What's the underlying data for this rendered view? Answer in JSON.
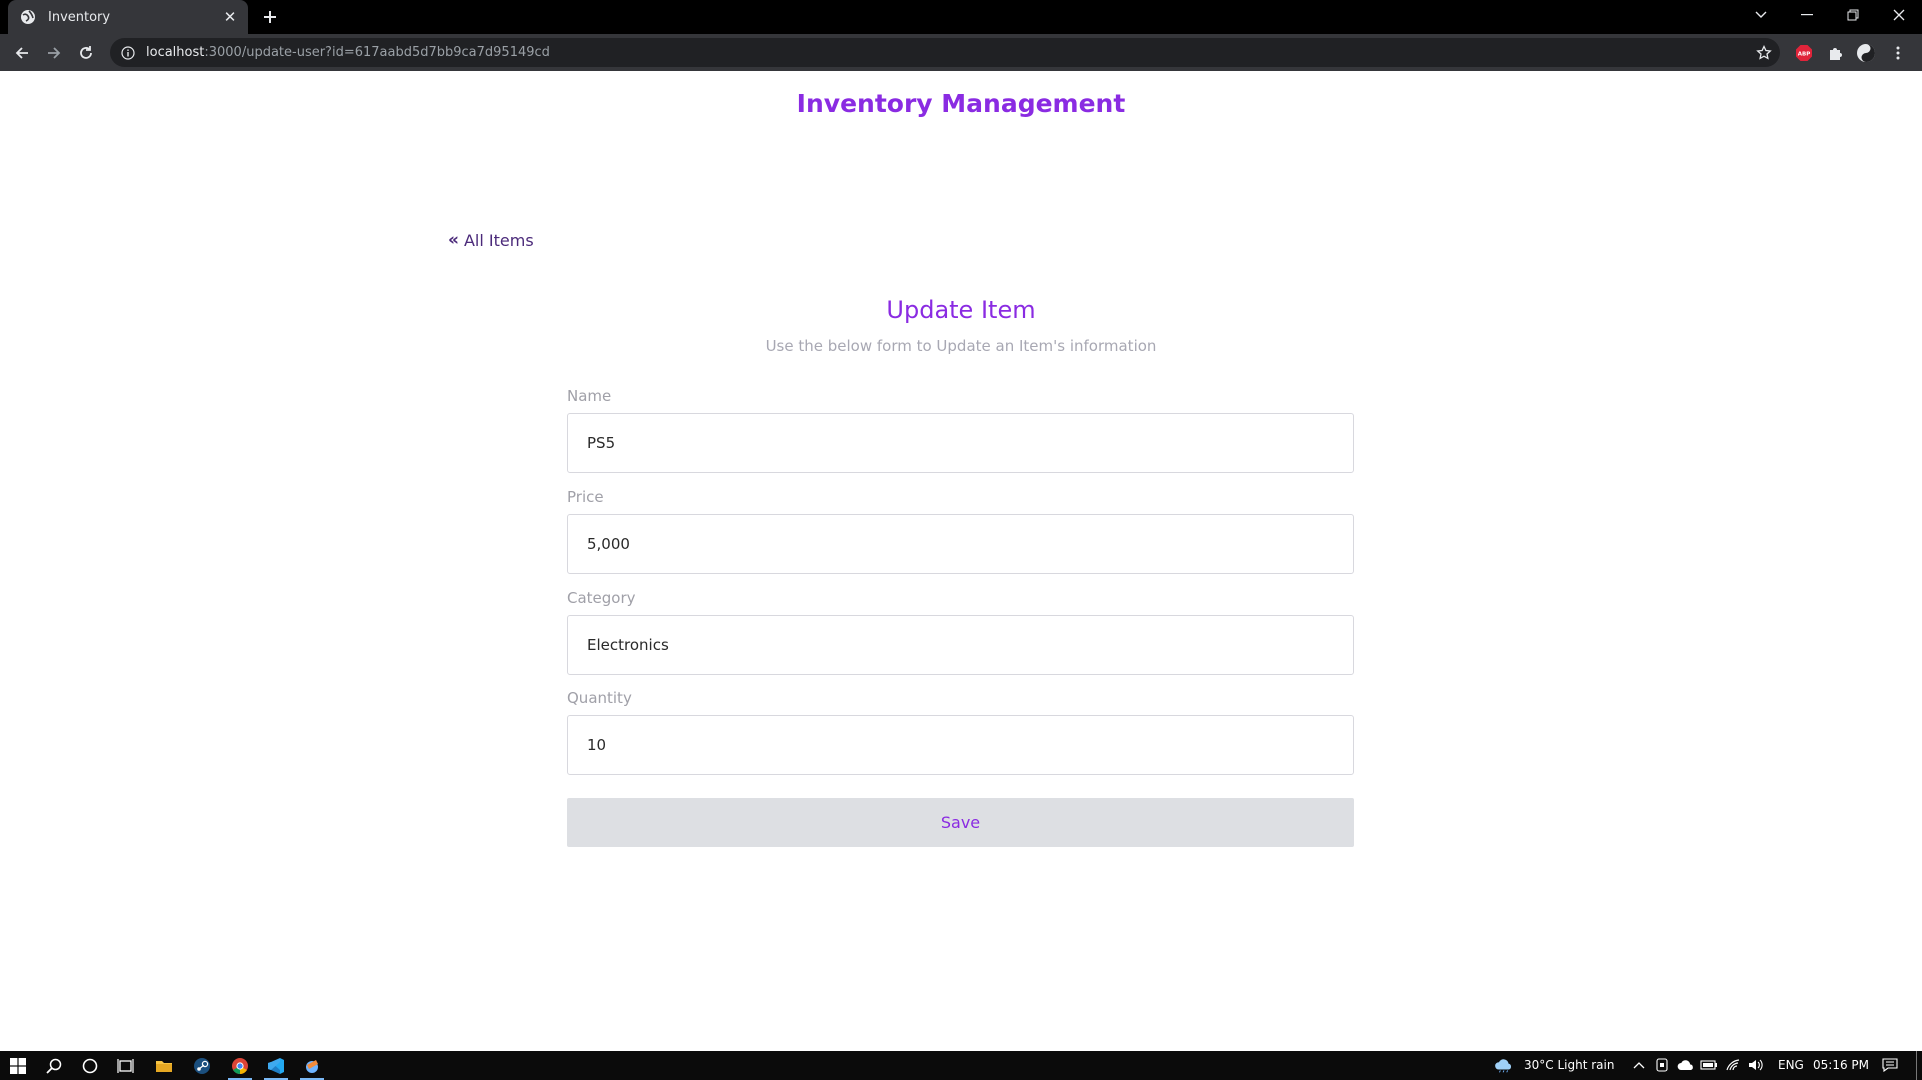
{
  "browser": {
    "tab_title": "Inventory",
    "url_host": "localhost",
    "url_rest": ":3000/update-user?id=617aabd5d7bb9ca7d95149cd"
  },
  "page": {
    "brand": "Inventory Management",
    "back_link": "All Items",
    "form_title": "Update Item",
    "form_subtitle": "Use the below form to Update an Item's information",
    "fields": [
      {
        "label": "Name",
        "value": "PS5"
      },
      {
        "label": "Price",
        "value": "5,000"
      },
      {
        "label": "Category",
        "value": "Electronics"
      },
      {
        "label": "Quantity",
        "value": "10"
      }
    ],
    "save_label": "Save"
  },
  "taskbar": {
    "weather": "30°C  Light rain",
    "language": "ENG",
    "time": "05:16 PM"
  },
  "colors": {
    "accent": "#8a2be2",
    "back_link": "#4b2a7a",
    "muted_text": "#a0a0a8",
    "button_bg": "#dddfe3"
  }
}
